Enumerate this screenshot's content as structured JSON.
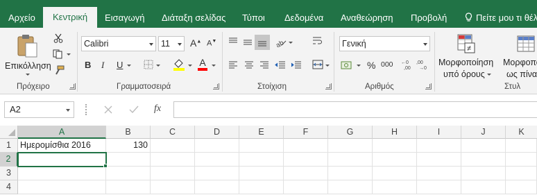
{
  "tabs": [
    "Αρχείο",
    "Κεντρική",
    "Εισαγωγή",
    "Διάταξη σελίδας",
    "Τύποι",
    "Δεδομένα",
    "Αναθεώρηση",
    "Προβολή"
  ],
  "tell_me": "Πείτε μου τι θέλ",
  "ribbon": {
    "clipboard": {
      "paste_label": "Επικόλληση",
      "group_label": "Πρόχειρο"
    },
    "font": {
      "font_name": "Calibri",
      "font_size": "11",
      "bold": "B",
      "italic": "I",
      "underline": "U",
      "group_label": "Γραμματοσειρά"
    },
    "alignment": {
      "group_label": "Στοίχιση"
    },
    "number": {
      "format": "Γενική",
      "percent": "%",
      "thousands": "000",
      "group_label": "Αριθμός"
    },
    "styles": {
      "conditional_line1": "Μορφοποίηση",
      "conditional_line2": "υπό όρους",
      "table_line1": "Μορφοπο",
      "table_line2": "ως πίνακ",
      "group_label": "Στυλ"
    }
  },
  "formula_bar": {
    "name_box": "A2",
    "fx": "fx",
    "formula": ""
  },
  "sheet": {
    "columns": [
      "A",
      "B",
      "C",
      "D",
      "E",
      "F",
      "G",
      "H",
      "I",
      "J",
      "K"
    ],
    "rows": [
      "1",
      "2",
      "3",
      "4"
    ],
    "cells": {
      "A1": "Ημερομίσθια 2016",
      "B1": "130"
    },
    "active_cell": "A2"
  }
}
